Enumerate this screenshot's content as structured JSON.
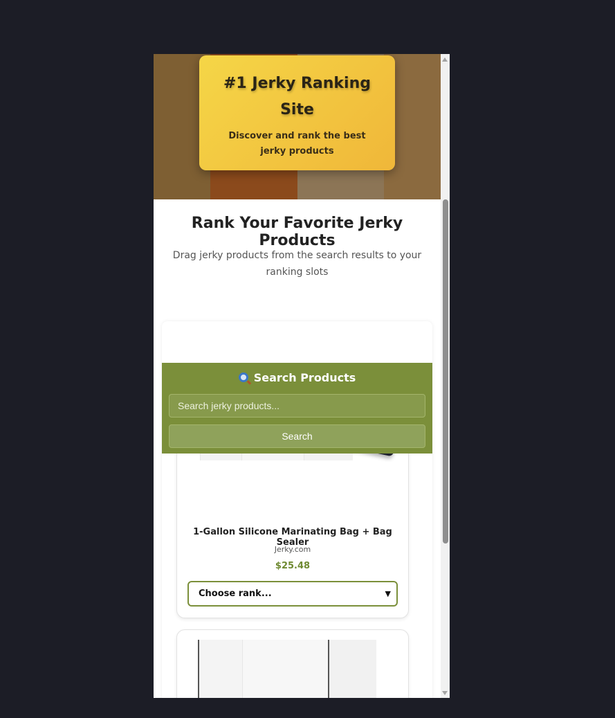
{
  "hero": {
    "title": "#1 Jerky Ranking Site",
    "subtitle": "Discover and rank the best jerky products"
  },
  "intro": {
    "title": "Rank Your Favorite Jerky Products",
    "subtitle": "Drag jerky products from the search results to your ranking slots"
  },
  "search": {
    "title": "Search Products",
    "placeholder": "Search jerky products...",
    "button_label": "Search",
    "icon": "magnifying-glass-icon"
  },
  "products": [
    {
      "name": "1-Gallon Silicone Marinating Bag + Bag Sealer",
      "vendor": "Jerky.com",
      "price": "$25.48",
      "rank_select": "Choose rank..."
    }
  ],
  "colors": {
    "background": "#1c1d26",
    "accent_green": "#7b8f3a",
    "price_green": "#6f8a32",
    "hero_gold": "#f0b739"
  }
}
